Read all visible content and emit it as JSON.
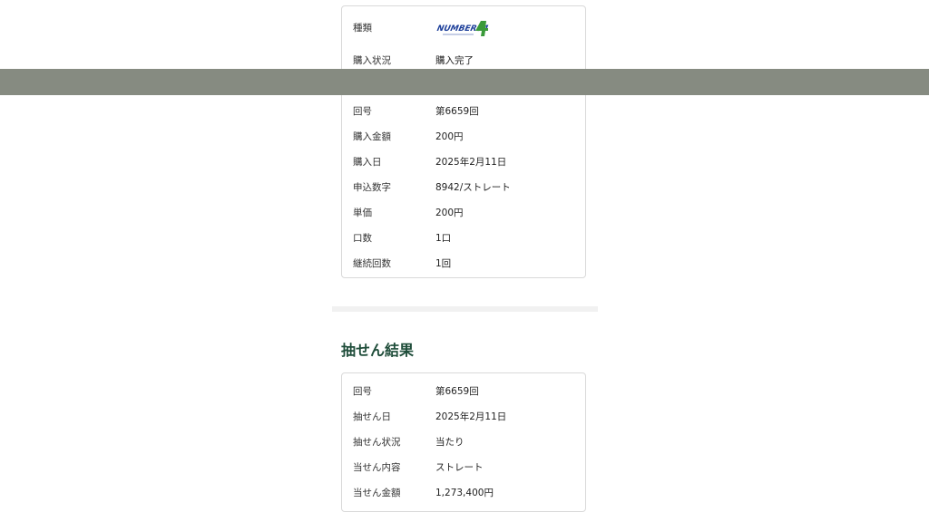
{
  "purchase_details": {
    "rows": [
      {
        "label": "種類",
        "logo_text": "NUMBERS4"
      },
      {
        "label": "購入状況",
        "value": "購入完了"
      },
      {
        "label": "回号",
        "value": "第6659回"
      },
      {
        "label": "購入金額",
        "value": "200円"
      },
      {
        "label": "購入日",
        "value": "2025年2月11日"
      },
      {
        "label": "申込数字",
        "value": "8942/ストレート"
      },
      {
        "label": "単価",
        "value": "200円"
      },
      {
        "label": "口数",
        "value": "1口"
      },
      {
        "label": "継続回数",
        "value": "1回"
      }
    ]
  },
  "lottery_result": {
    "title": "抽せん結果",
    "rows": [
      {
        "label": "回号",
        "value": "第6659回"
      },
      {
        "label": "抽せん日",
        "value": "2025年2月11日"
      },
      {
        "label": "抽せん状況",
        "value": "当たり"
      },
      {
        "label": "当せん内容",
        "value": "ストレート"
      },
      {
        "label": "当せん金額",
        "value": "1,273,400円"
      }
    ]
  },
  "colors": {
    "overlay_bar": "#868b81",
    "section_title": "#1f4d3a",
    "logo_blue": "#1d3f9a",
    "logo_green": "#3a9a3a"
  }
}
